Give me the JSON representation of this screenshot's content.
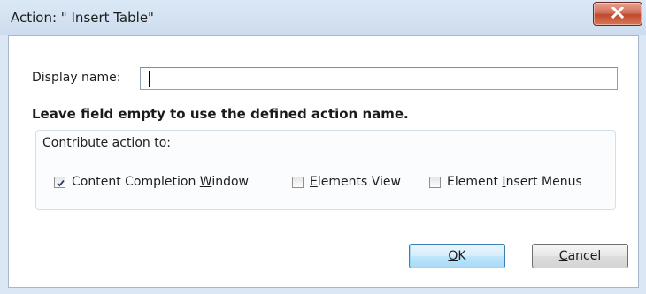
{
  "window": {
    "title": "Action: \" Insert Table\""
  },
  "form": {
    "display_name_label": "Display name:",
    "display_name_value": "",
    "hint": "Leave field empty to use the defined action name."
  },
  "contribute": {
    "group_label": "Contribute action to:",
    "options": [
      {
        "pre": "Content Completion ",
        "mnemonic": "W",
        "post": "indow",
        "checked": true
      },
      {
        "pre": "",
        "mnemonic": "E",
        "post": "lements View",
        "checked": false
      },
      {
        "pre": "Element ",
        "mnemonic": "I",
        "post": "nsert Menus",
        "checked": false
      }
    ]
  },
  "buttons": {
    "ok": {
      "mnemonic": "O",
      "post": "K"
    },
    "cancel": {
      "mnemonic": "C",
      "post": "ancel"
    }
  },
  "colors": {
    "frame": "#dbe7f4",
    "close_button": "#c04a2e",
    "default_button_border": "#3c7fb1"
  }
}
